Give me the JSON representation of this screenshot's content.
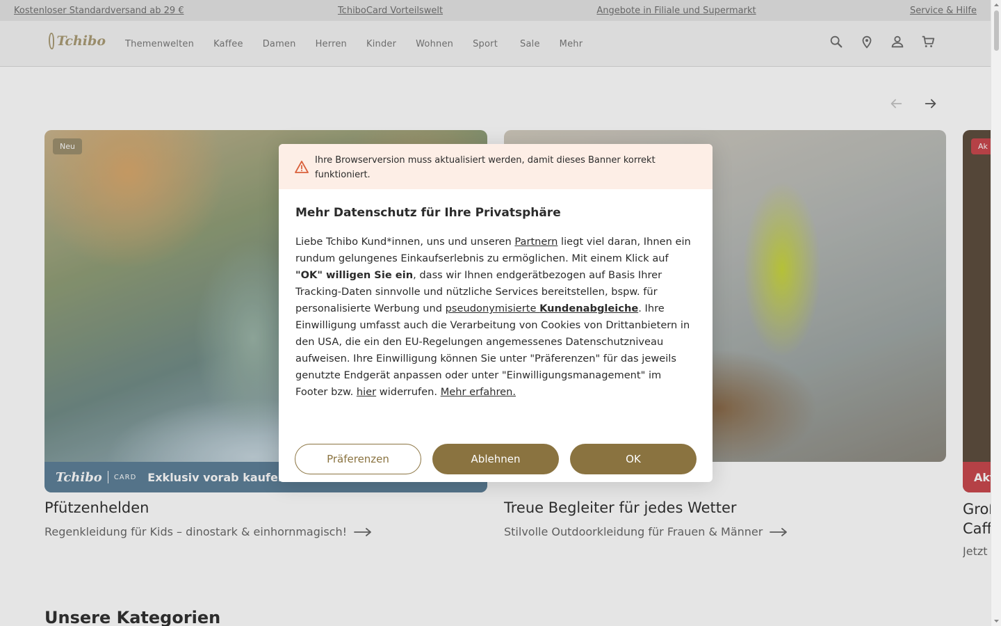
{
  "topbar": {
    "links": [
      "Kostenloser Standardversand ab 29 €",
      "TchiboCard Vorteilswelt",
      "Angebote in Filiale und Supermarkt",
      "Service & Hilfe"
    ]
  },
  "header": {
    "logo": "Tchibo",
    "nav": [
      "Themenwelten",
      "Kaffee",
      "Damen",
      "Herren",
      "Kinder",
      "Wohnen",
      "Sport",
      "Sale",
      "Mehr"
    ],
    "icons": [
      "search-icon",
      "location-icon",
      "account-icon",
      "cart-icon"
    ]
  },
  "cards": [
    {
      "badge": "Neu",
      "banner_logo": "Tchibo",
      "banner_card": "CARD",
      "banner_label": "Exklusiv vorab kaufen",
      "title": "Pfützenhelden",
      "subtitle": "Regenkleidung für Kids – dinostark & einhornmagisch!"
    },
    {
      "title": "Treue Begleiter für jedes Wetter",
      "subtitle": "Stilvolle Outdoorkleidung für Frauen & Männer"
    },
    {
      "badge": "Ak",
      "banner_label": "Akt",
      "title_line1": "Groß",
      "title_line2": "Caffè",
      "subtitle": "Jetzt"
    }
  ],
  "categories_title": "Unsere Kategorien",
  "modal": {
    "warning": "Ihre Browserversion muss aktualisiert werden, damit dieses Banner korrekt funktioniert.",
    "title": "Mehr Datenschutz für Ihre Privatsphäre",
    "body": {
      "p1": "Liebe Tchibo Kund*innen, uns und unseren ",
      "link_partner": "Partnern",
      "p2": " liegt viel daran, Ihnen ein rundum gelungenes Einkaufserlebnis zu ermöglichen. Mit einem Klick auf ",
      "bold_ok": "\"OK\" willigen Sie ein",
      "p3": ", dass wir Ihnen endgerätbezogen auf Basis Ihrer Tracking-Daten sinnvolle und nützliche Services bereitstellen, bspw. für personalisierte Werbung und ",
      "link_pseudo": "pseudonymisierte ",
      "link_pseudo_bold": "Kundenabgleiche",
      "p4": ". Ihre Einwilligung umfasst auch die Verarbeitung von Cookies von Drittanbietern in den USA, die ein den EU-Regelungen angemessenes Datenschutzniveau aufweisen. Ihre Einwilligung können Sie unter \"Präferenzen\" für das jeweils genutzte Endgerät anpassen oder unter \"Einwilligungsmanagement\" im Footer bzw. ",
      "link_hier": "hier",
      "p5": " widerrufen. ",
      "link_more": "Mehr erfahren."
    },
    "buttons": {
      "preferences": "Präferenzen",
      "decline": "Ablehnen",
      "ok": "OK"
    }
  },
  "colors": {
    "brand_gold": "#8a7340",
    "warning_bg": "#fdeee6",
    "card_banner_blue": "#5b7e97",
    "sale_red": "#c9454a"
  }
}
